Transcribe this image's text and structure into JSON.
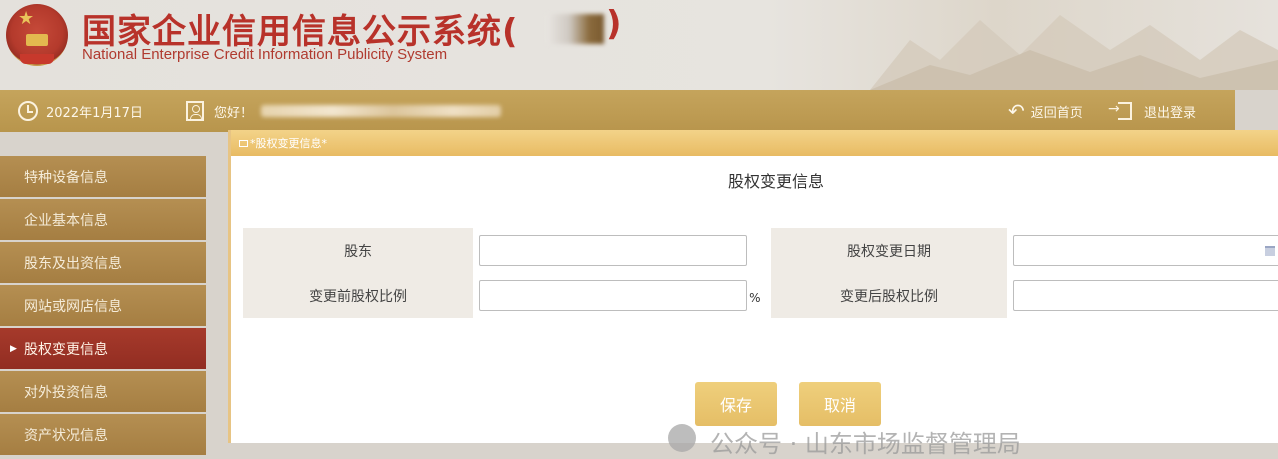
{
  "header": {
    "title_cn": "国家企业信用信息公示系统(",
    "title_close": ")",
    "title_en": "National Enterprise Credit Information Publicity System"
  },
  "infobar": {
    "date": "2022年1月17日",
    "greeting": "您好！",
    "home_label": "返回首页",
    "logout_label": "退出登录"
  },
  "sidebar": {
    "items": [
      {
        "label": "特种设备信息",
        "active": false
      },
      {
        "label": "企业基本信息",
        "active": false
      },
      {
        "label": "股东及出资信息",
        "active": false
      },
      {
        "label": "网站或网店信息",
        "active": false
      },
      {
        "label": "股权变更信息",
        "active": true
      },
      {
        "label": "对外投资信息",
        "active": false
      },
      {
        "label": "资产状况信息",
        "active": false
      }
    ]
  },
  "modal": {
    "window_title": "*股权变更信息*",
    "section_title": "股权变更信息",
    "form": {
      "shareholder_label": "股东",
      "shareholder_value": "",
      "change_date_label": "股权变更日期",
      "change_date_value": "",
      "before_ratio_label": "变更前股权比例",
      "before_ratio_value": "",
      "before_ratio_unit": "%",
      "after_ratio_label": "变更后股权比例",
      "after_ratio_value": ""
    },
    "save_label": "保存",
    "cancel_label": "取消"
  },
  "watermark": {
    "text": "公众号 · 山东市场监督管理局"
  },
  "colors": {
    "title_red": "#b8322a",
    "bar_gold": "#c5a45c",
    "sidebar_brown": "#b58f52",
    "sidebar_active": "#a63a2b",
    "button_gold": "#e5be66"
  },
  "icons": {
    "date": "clock-icon",
    "user": "user-icon",
    "home": "back-arrow-icon",
    "logout": "logout-icon",
    "emblem": "national-emblem-icon",
    "calendar": "calendar-icon"
  }
}
